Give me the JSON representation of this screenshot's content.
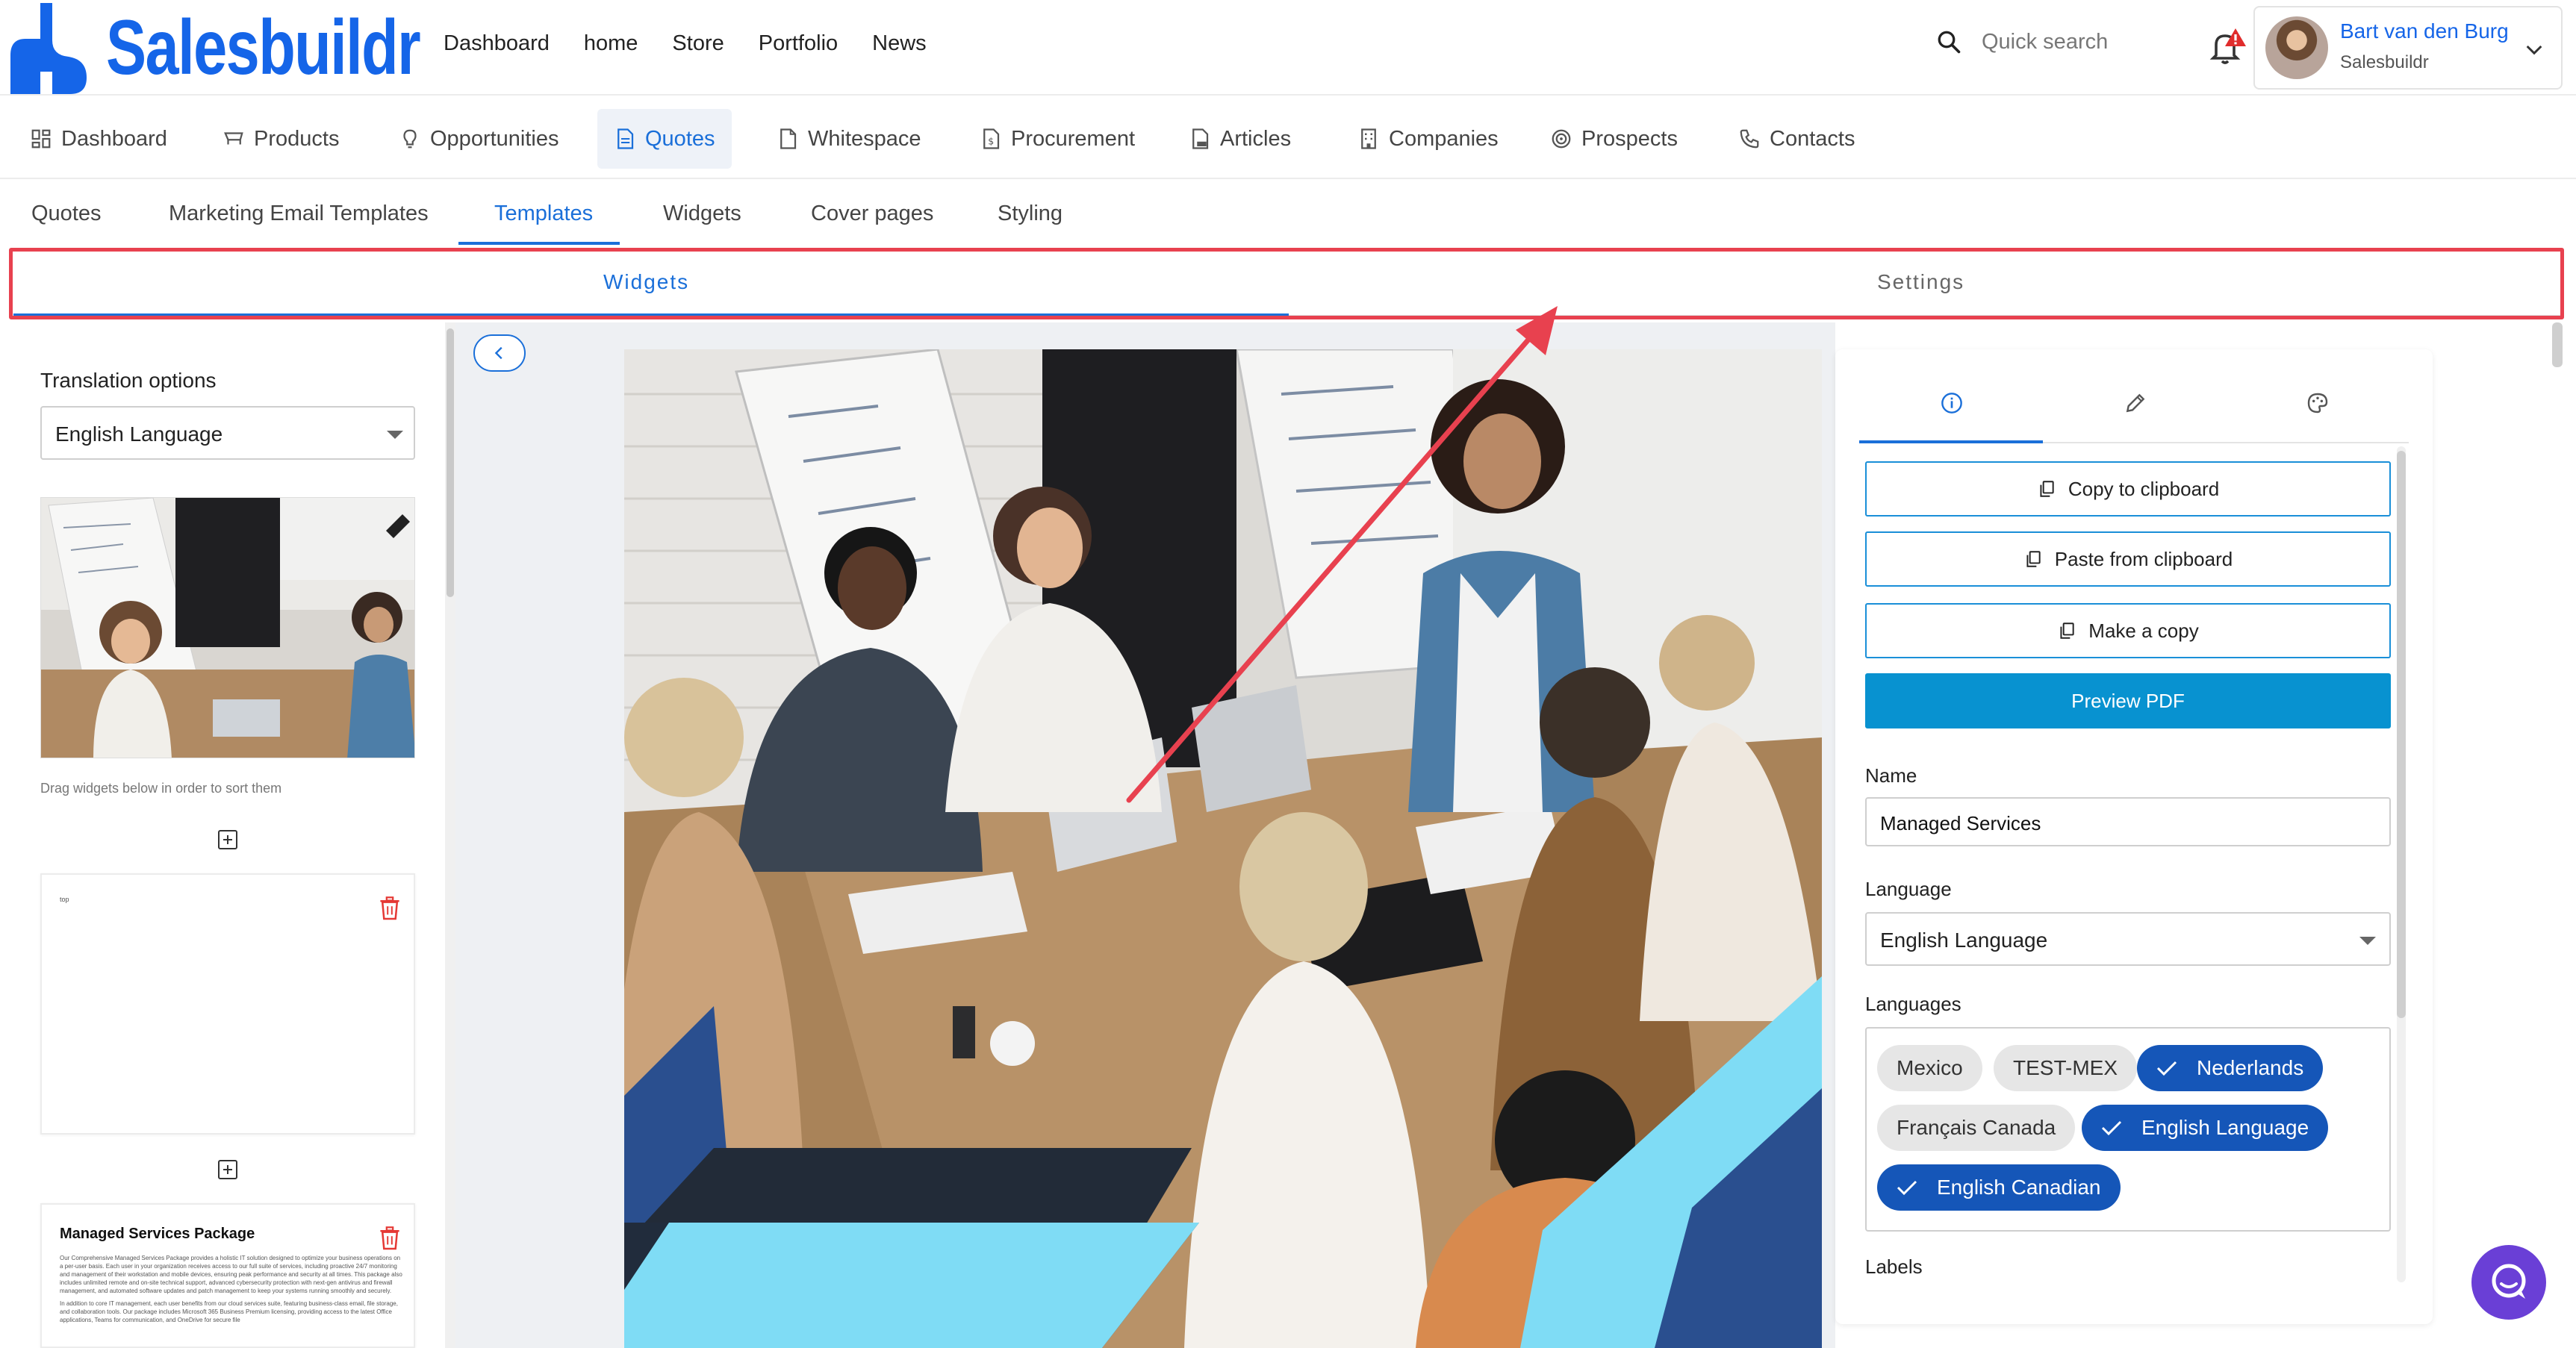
{
  "brand": {
    "name": "Salesbuildr",
    "color": "#1565e8"
  },
  "top_nav": [
    "Dashboard",
    "home",
    "Store",
    "Portfolio",
    "News"
  ],
  "search": {
    "placeholder": "Quick search"
  },
  "user": {
    "name": "Bart van den Burg",
    "org": "Salesbuildr"
  },
  "modules": [
    {
      "label": "Dashboard",
      "icon": "grid-icon"
    },
    {
      "label": "Products",
      "icon": "cart-icon"
    },
    {
      "label": "Opportunities",
      "icon": "bulb-icon"
    },
    {
      "label": "Quotes",
      "icon": "document-icon",
      "active": true
    },
    {
      "label": "Whitespace",
      "icon": "file-icon"
    },
    {
      "label": "Procurement",
      "icon": "file-dollar-icon"
    },
    {
      "label": "Articles",
      "icon": "file-pdf-icon"
    },
    {
      "label": "Companies",
      "icon": "building-icon"
    },
    {
      "label": "Prospects",
      "icon": "target-icon"
    },
    {
      "label": "Contacts",
      "icon": "phone-icon"
    }
  ],
  "sub_nav": [
    "Quotes",
    "Marketing Email Templates",
    "Templates",
    "Widgets",
    "Cover pages",
    "Styling"
  ],
  "sub_nav_active": "Templates",
  "editor_tabs": {
    "widgets": "Widgets",
    "settings": "Settings"
  },
  "left": {
    "translation_label": "Translation options",
    "translation_value": "English Language",
    "drag_hint": "Drag widgets below in order to sort them",
    "card1_text": "top",
    "card2_title": "Managed Services Package",
    "card2_body": "Our Comprehensive Managed Services Package provides a holistic IT solution designed to optimize your business operations on a per-user basis. Each user in your organization receives access to our full suite of services, including proactive 24/7 monitoring and management of their workstation and mobile devices, ensuring peak performance and security at all times. This package also includes unlimited remote and on-site technical support, advanced cybersecurity protection with next-gen antivirus and firewall management, and automated software updates and patch management to keep your systems running smoothly and securely.",
    "card2_body2": "In addition to core IT management, each user benefits from our cloud services suite, featuring business-class email, file storage, and collaboration tools. Our package includes Microsoft 365 Business Premium licensing, providing access to the latest Office applications, Teams for communication, and OneDrive for secure file"
  },
  "right": {
    "buttons": {
      "copy": "Copy to clipboard",
      "paste": "Paste from clipboard",
      "make_copy": "Make a copy",
      "preview": "Preview PDF"
    },
    "name_label": "Name",
    "name_value": "Managed Services",
    "language_label": "Language",
    "language_value": "English Language",
    "languages_label": "Languages",
    "languages": [
      {
        "label": "Mexico",
        "selected": false
      },
      {
        "label": "TEST-MEX",
        "selected": false
      },
      {
        "label": "Nederlands",
        "selected": true
      },
      {
        "label": "Français Canada",
        "selected": false
      },
      {
        "label": "English Language",
        "selected": true
      },
      {
        "label": "English Canadian",
        "selected": true
      }
    ],
    "labels_label": "Labels"
  },
  "colors": {
    "accent": "#1a6fd9",
    "primary_button": "#0892d0",
    "chip_selected": "#1556b8",
    "annotation": "#e8414f",
    "chat": "#6a3fd6"
  }
}
